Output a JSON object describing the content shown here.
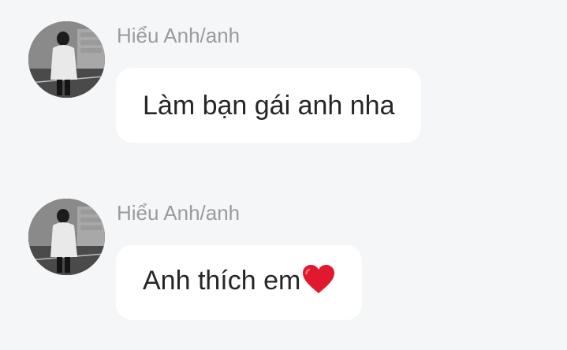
{
  "messages": [
    {
      "sender": "Hiểu Anh/anh",
      "text": "Làm bạn gái anh nha",
      "emoji": ""
    },
    {
      "sender": "Hiểu Anh/anh",
      "text": "Anh thích em",
      "emoji": "heart-icon"
    }
  ],
  "colors": {
    "background": "#f5f6f8",
    "bubble": "#ffffff",
    "sender_name": "#9b9b9b",
    "message_text": "#262626",
    "heart": "#e0192e"
  }
}
